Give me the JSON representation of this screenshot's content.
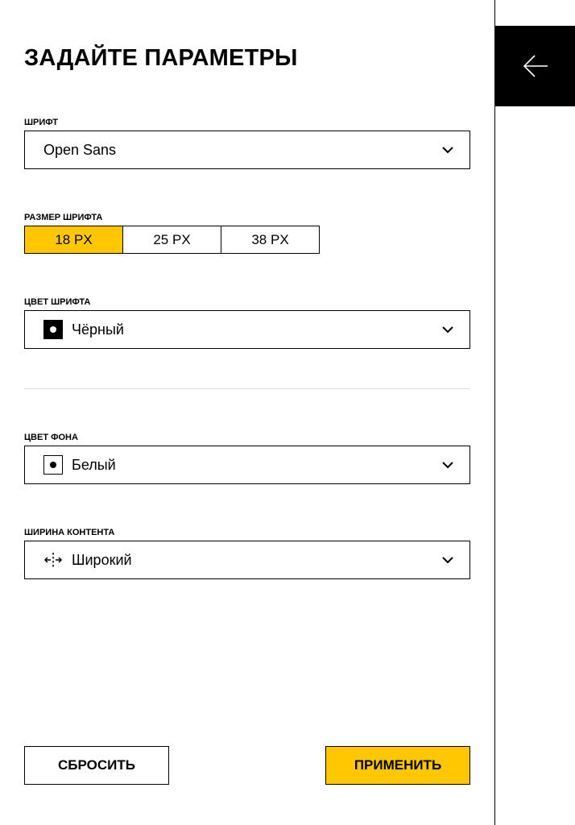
{
  "title": "ЗАДАЙТЕ ПАРАМЕТРЫ",
  "colors": {
    "accent": "#ffc700",
    "text": "#000000",
    "background": "#ffffff",
    "divider": "#dedede"
  },
  "font": {
    "label": "ШРИФТ",
    "value": "Open Sans",
    "icon": "chevron-down-icon"
  },
  "font_size": {
    "label": "РАЗМЕР ШРИФТА",
    "options": [
      "18 PX",
      "25 PX",
      "38 PX"
    ],
    "selected": "18 PX"
  },
  "font_color": {
    "label": "ЦВЕТ ШРИФТА",
    "value": "Чёрный",
    "icon": "black-swatch-icon"
  },
  "bg_color": {
    "label": "ЦВЕТ ФОНА",
    "value": "Белый",
    "icon": "white-swatch-icon"
  },
  "content_width": {
    "label": "ШИРИНА КОНТЕНТА",
    "value": "Широкий",
    "icon": "width-expand-icon"
  },
  "actions": {
    "reset": "СБРОСИТЬ",
    "apply": "ПРИМЕНИТЬ"
  },
  "side": {
    "back_icon": "arrow-left-icon"
  }
}
